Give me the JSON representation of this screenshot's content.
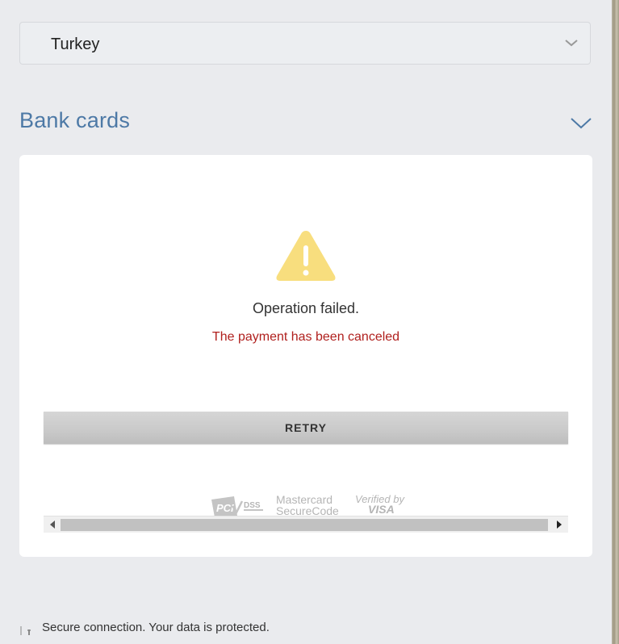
{
  "country_select": {
    "value": "Turkey",
    "icon": "chevron-down-icon"
  },
  "section": {
    "title": "Bank cards",
    "toggle_icon": "chevron-down-icon",
    "accent": "#4d79a6"
  },
  "status": {
    "icon": "warning-icon",
    "title": "Operation failed.",
    "detail": "The payment has been canceled",
    "detail_color": "#b0201e"
  },
  "actions": {
    "retry_label": "RETRY"
  },
  "logos": {
    "pci": "PCI DSS",
    "mastercard_line1": "Mastercard",
    "mastercard_line2": "SecureCode",
    "visa_line1": "Verified by",
    "visa_line2": "VISA"
  },
  "footer": {
    "text": "Secure connection. Your data is protected.",
    "icon": "lock-icon"
  }
}
